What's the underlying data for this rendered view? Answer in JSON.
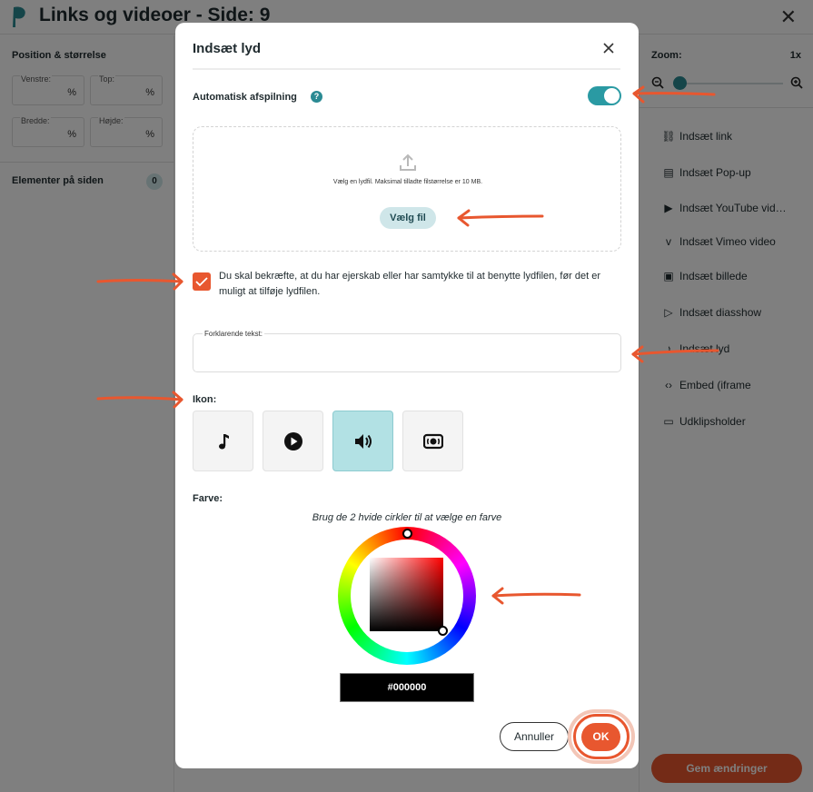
{
  "app": {
    "title": "Links og videoer - Side: 9"
  },
  "left_panel": {
    "heading": "Position & størrelse",
    "fields": [
      {
        "label": "Venstre:",
        "unit": "%"
      },
      {
        "label": "Top:",
        "unit": "%"
      },
      {
        "label": "Bredde:",
        "unit": "%"
      },
      {
        "label": "Højde:",
        "unit": "%"
      }
    ],
    "elements_label": "Elementer på siden",
    "elements_count": "0"
  },
  "right_panel": {
    "zoom_label": "Zoom:",
    "zoom_value": "1x",
    "items": [
      {
        "label": "Indsæt link",
        "icon": "link-icon"
      },
      {
        "label": "Indsæt Pop-up",
        "icon": "popup-icon"
      },
      {
        "label": "Indsæt YouTube vid…",
        "icon": "youtube-icon"
      },
      {
        "label": "Indsæt Vimeo video",
        "icon": "vimeo-icon"
      },
      {
        "label": "Indsæt billede",
        "icon": "image-icon"
      },
      {
        "label": "Indsæt diasshow",
        "icon": "slideshow-icon"
      },
      {
        "label": "Indsæt lyd",
        "icon": "music-note-icon"
      },
      {
        "label": "Embed (iframe",
        "icon": "code-icon"
      },
      {
        "label": "Udklipsholder",
        "icon": "clipboard-icon"
      }
    ],
    "save_label": "Gem ændringer"
  },
  "modal": {
    "title": "Indsæt lyd",
    "autoplay_label": "Automatisk afspilning",
    "autoplay_on": true,
    "help_glyph": "?",
    "dropzone_text": "Vælg en lydfil. Maksimal tilladte filstørrelse er 10 MB.",
    "choose_file_label": "Vælg fil",
    "consent_text": "Du skal bekræfte, at du har ejerskab eller har samtykke til at benytte lydfilen, før det er muligt at tilføje lydfilen.",
    "consent_checked": true,
    "explain_label": "Forklarende tekst:",
    "explain_value": "",
    "icon_label": "Ikon:",
    "icon_options": [
      "music-note-icon",
      "play-circle-icon",
      "speaker-icon",
      "sound-wave-icon"
    ],
    "selected_icon": "speaker-icon",
    "color_label": "Farve:",
    "color_hint": "Brug de 2 hvide cirkler til at vælge en farve",
    "color_hex": "#000000",
    "cancel_label": "Annuller",
    "ok_label": "OK"
  },
  "colors": {
    "accent": "#e8572f",
    "teal": "#2a9aa3",
    "icon_selected": "#b2e1e4"
  }
}
